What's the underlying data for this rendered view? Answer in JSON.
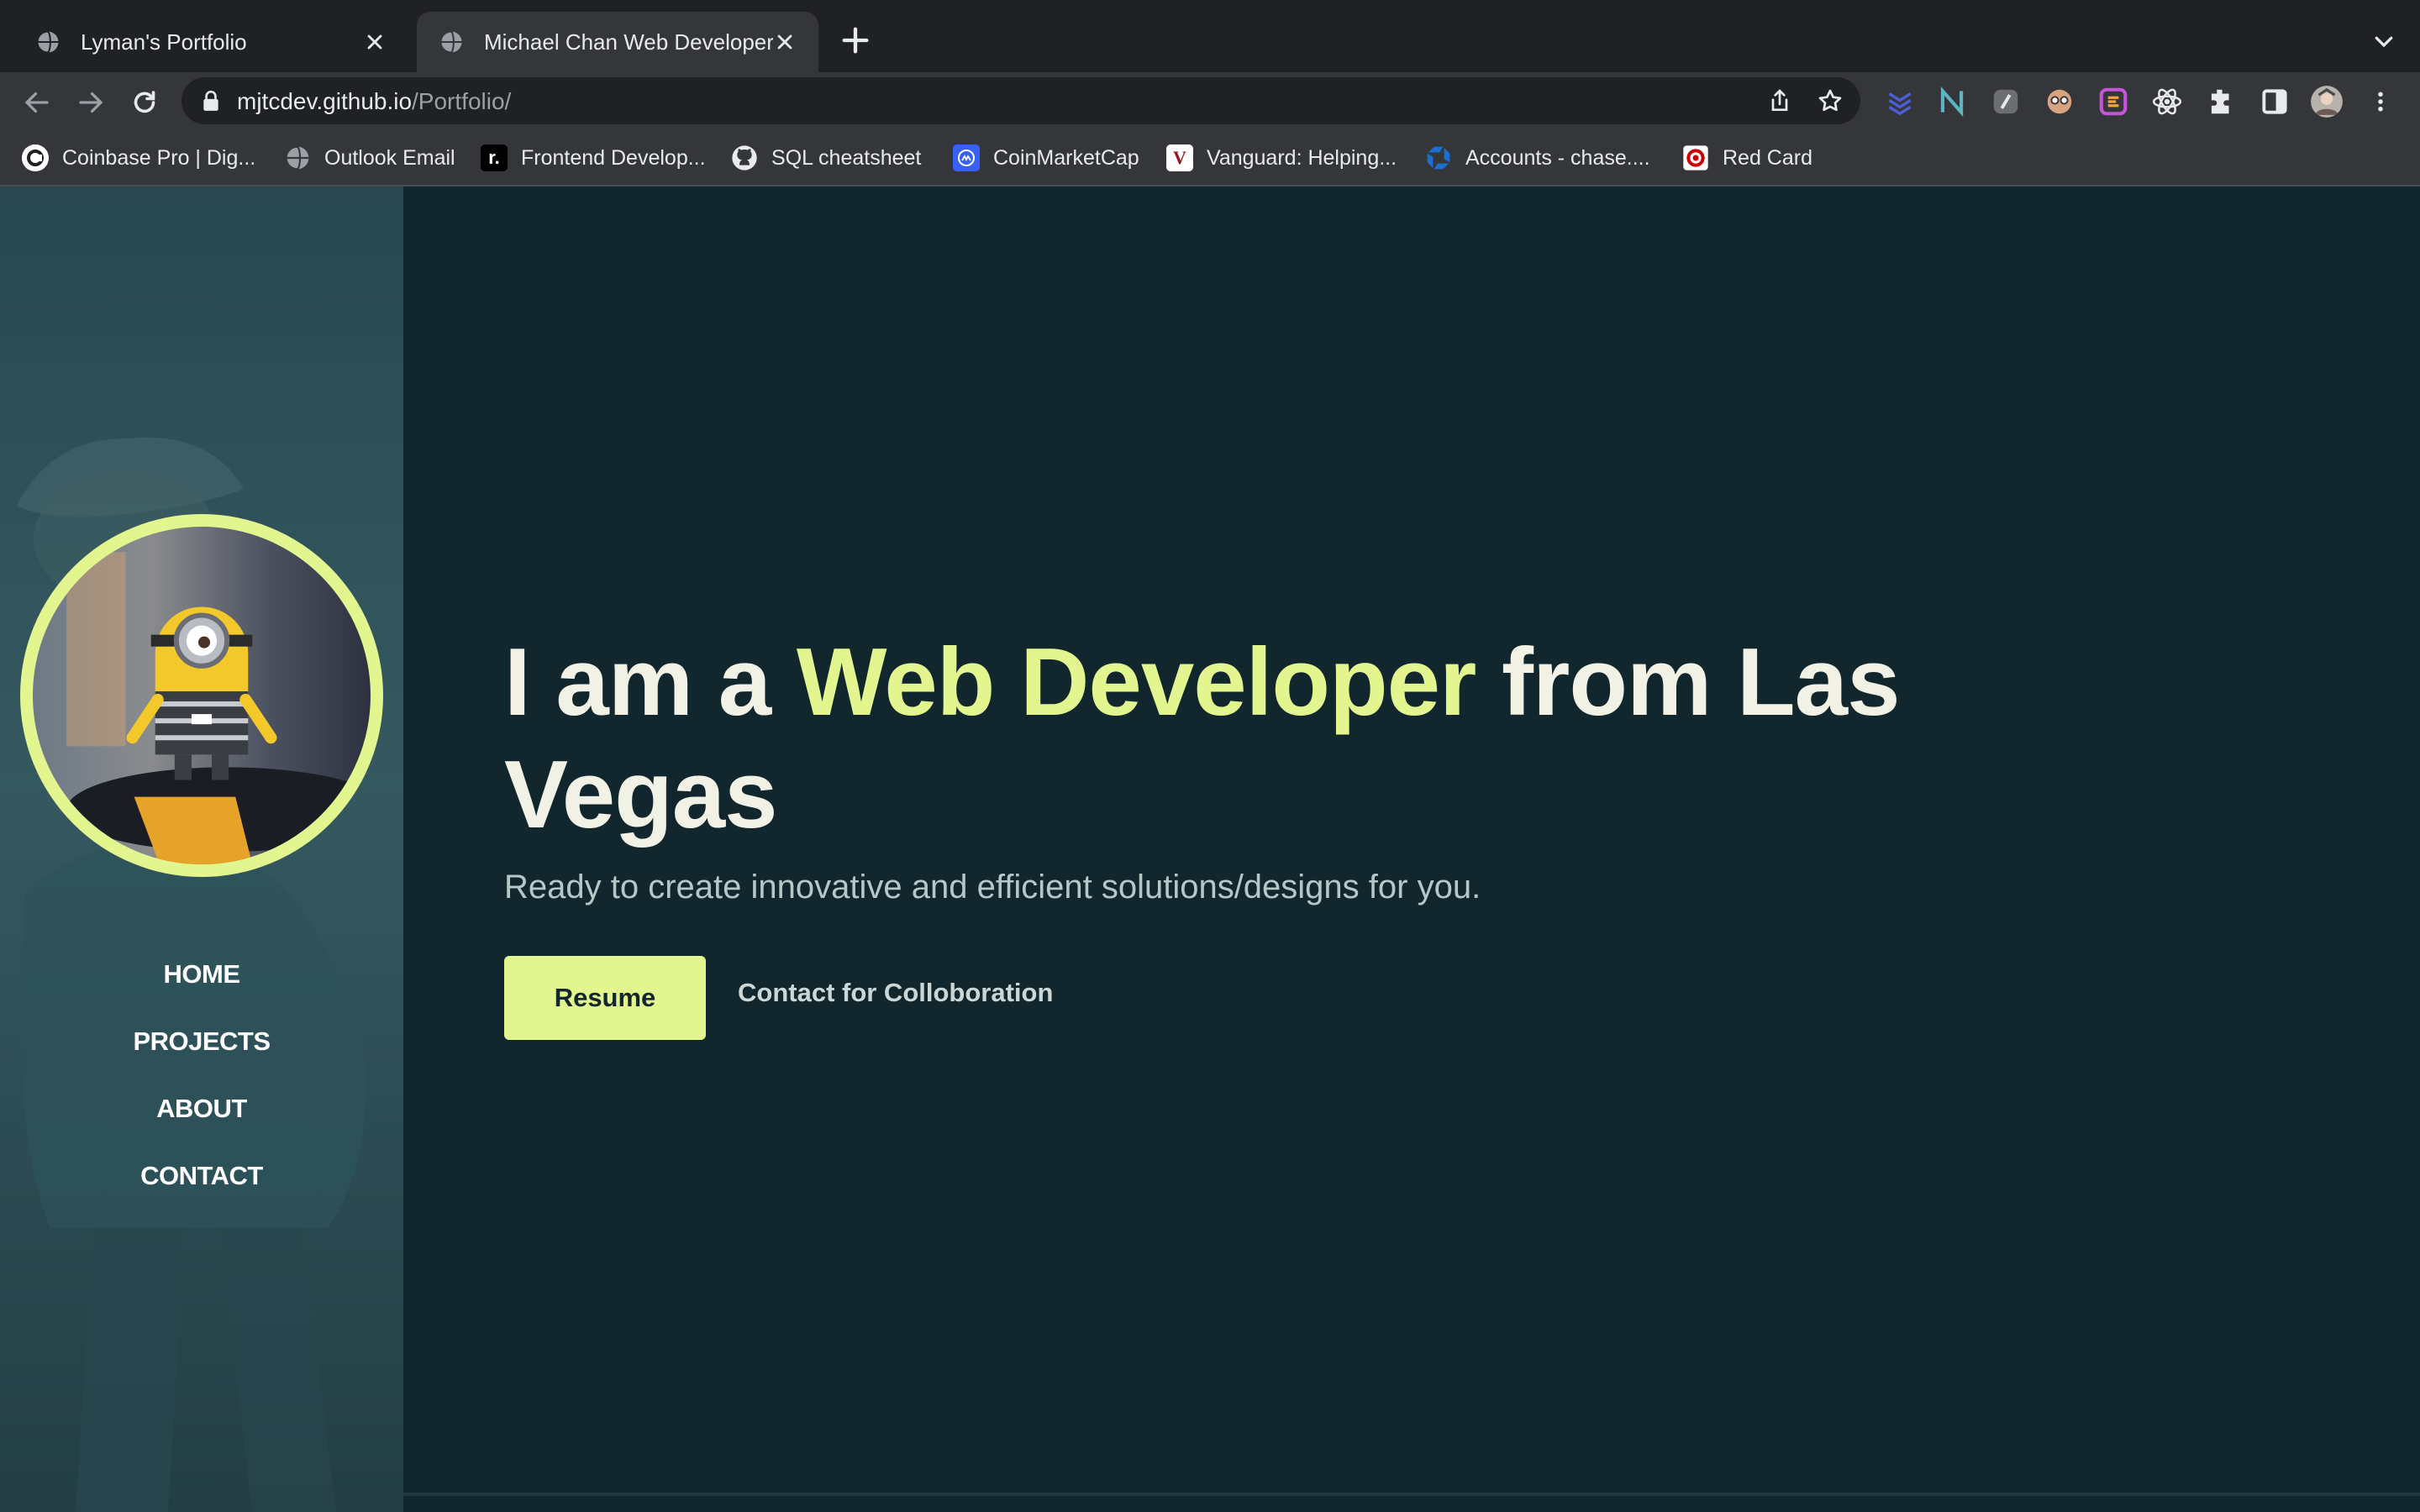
{
  "browser": {
    "tabs": [
      {
        "title": "Lyman's Portfolio",
        "active": false
      },
      {
        "title": "Michael Chan Web Developer",
        "active": true
      }
    ],
    "url_host": "mjtcdev.github.io",
    "url_path": "/Portfolio/",
    "bookmarks": [
      {
        "label": "Coinbase Pro | Dig...",
        "icon": "coinbase-icon"
      },
      {
        "label": "Outlook Email",
        "icon": "globe-icon"
      },
      {
        "label": "Frontend Develop...",
        "icon": "frontend-mentor-icon"
      },
      {
        "label": "SQL cheatsheet",
        "icon": "github-icon"
      },
      {
        "label": "CoinMarketCap",
        "icon": "coinmarketcap-icon"
      },
      {
        "label": "Vanguard: Helping...",
        "icon": "vanguard-icon"
      },
      {
        "label": "Accounts - chase....",
        "icon": "chase-icon"
      },
      {
        "label": "Red Card",
        "icon": "target-icon"
      }
    ],
    "colors": {
      "tabstrip": "#202124",
      "toolbar": "#35363a"
    }
  },
  "nav": {
    "items": [
      "HOME",
      "PROJECTS",
      "ABOUT",
      "CONTACT"
    ]
  },
  "hero": {
    "title_prefix": "I am a ",
    "title_accent": "Web Developer",
    "title_suffix": " from Las Vegas",
    "subtitle": "Ready to create innovative and efficient solutions/designs for you.",
    "resume_label": "Resume",
    "contact_label": "Contact for Colloboration"
  },
  "colors": {
    "accent": "#e2f58f",
    "background": "#12262d",
    "heading": "#f1f1e6"
  }
}
